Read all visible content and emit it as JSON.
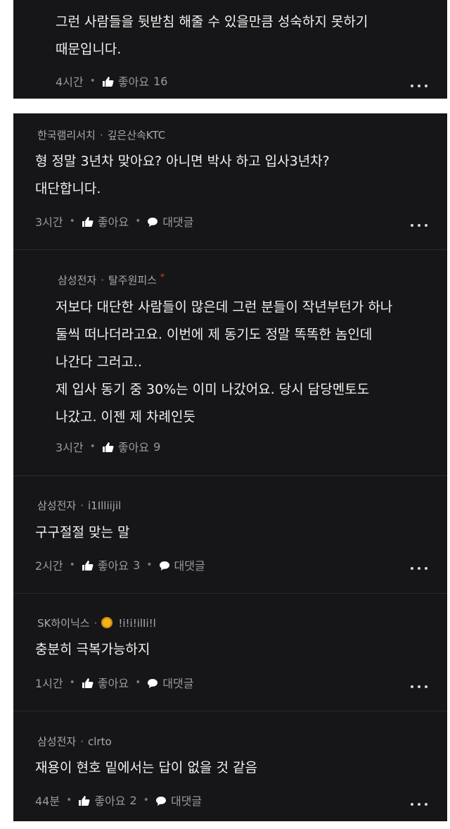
{
  "top_comment": {
    "lines": [
      "그런 사람들을 뒷받침 해줄 수 있을만큼 성숙하지 못하기",
      "때문입니다."
    ],
    "time": "4시간",
    "like_label": "좋아요",
    "like_count": "16"
  },
  "comments": [
    {
      "company": "한국램리서치",
      "nickname": "깊은산속KTC",
      "lines": [
        "형 정말 3년차 맞아요? 아니면 박사 하고 입사3년차?",
        "대단합니다."
      ],
      "time": "3시간",
      "like_label": "좋아요",
      "reply_label": "대댓글"
    },
    {
      "company": "삼성전자",
      "nickname": "탈주원피스",
      "badge": "*",
      "lines": [
        "저보다 대단한 사람들이 많은데 그런 분들이 작년부턴가 하나",
        "둘씩 떠나더라고요. 이번에 제 동기도 정말 똑똑한 놈인데",
        "나간다 그러고..",
        "제 입사 동기 중 30%는 이미 나갔어요. 당시 담당멘토도",
        "나갔고. 이젠 제 차례인듯"
      ],
      "time": "3시간",
      "like_label": "좋아요",
      "like_count": "9"
    },
    {
      "company": "삼성전자",
      "nickname": "i1Illiijil",
      "lines": [
        "구구절절 맞는 말"
      ],
      "time": "2시간",
      "like_label": "좋아요",
      "like_count": "3",
      "reply_label": "대댓글"
    },
    {
      "company": "SK하이닉스",
      "nickname": "!i!i!ilIi!l",
      "lines": [
        "충분히 극복가능하지"
      ],
      "time": "1시간",
      "like_label": "좋아요",
      "reply_label": "대댓글"
    },
    {
      "company": "삼성전자",
      "nickname": "clrto",
      "lines": [
        "재용이 현호 밑에서는 답이 없을 것 같음"
      ],
      "time": "44분",
      "like_label": "좋아요",
      "like_count": "2",
      "reply_label": "대댓글"
    }
  ],
  "icons": {
    "like": "thumbs-up-icon",
    "reply": "speech-bubble-icon",
    "more": "more-dots-icon",
    "emoji": "sunflower-emoji-icon"
  },
  "colors": {
    "card_bg": "#161618",
    "text": "#f1f1f1",
    "muted": "#9a9a9e",
    "badge": "#e23b3b"
  }
}
